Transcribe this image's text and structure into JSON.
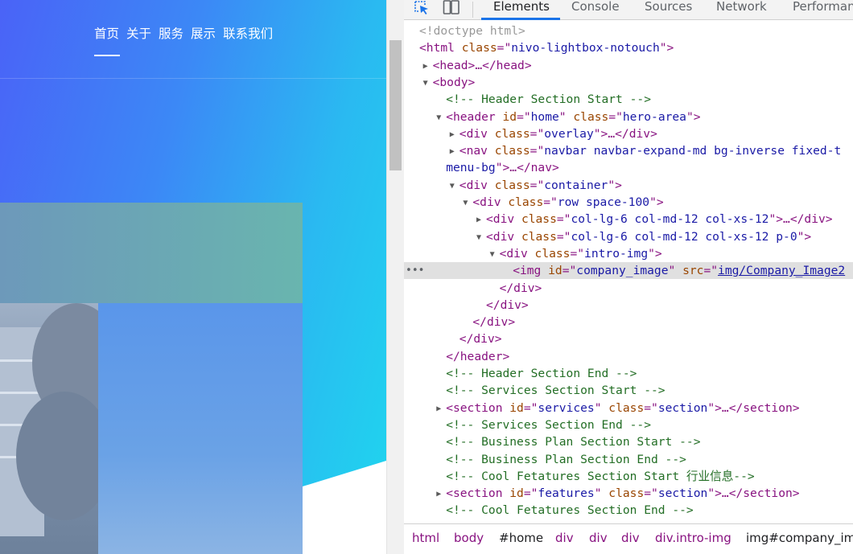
{
  "site": {
    "nav_links": [
      "首页",
      "关于",
      "服务",
      "展示",
      "联系我们"
    ],
    "active_link": "首页"
  },
  "devtools": {
    "tabs": [
      "Elements",
      "Console",
      "Sources",
      "Network",
      "Performan"
    ],
    "active_tab": "Elements",
    "selected_gutter": "•••",
    "tree": [
      {
        "indent": 0,
        "tri": "",
        "parts": [
          [
            "doctype",
            "<!doctype html>"
          ]
        ]
      },
      {
        "indent": 0,
        "tri": "",
        "parts": [
          [
            "tag",
            "<html "
          ],
          [
            "attr",
            "class"
          ],
          [
            "tag",
            "=\""
          ],
          [
            "val",
            "nivo-lightbox-notouch"
          ],
          [
            "tag",
            "\">"
          ]
        ]
      },
      {
        "indent": 1,
        "tri": "right",
        "parts": [
          [
            "tag",
            "<head>"
          ],
          [
            "ell",
            "…"
          ],
          [
            "tag",
            "</head>"
          ]
        ]
      },
      {
        "indent": 1,
        "tri": "down",
        "parts": [
          [
            "tag",
            "<body>"
          ]
        ]
      },
      {
        "indent": 2,
        "tri": "",
        "parts": [
          [
            "cmt",
            "<!-- Header Section Start -->"
          ]
        ]
      },
      {
        "indent": 2,
        "tri": "down",
        "parts": [
          [
            "tag",
            "<header "
          ],
          [
            "attr",
            "id"
          ],
          [
            "tag",
            "=\""
          ],
          [
            "val",
            "home"
          ],
          [
            "tag",
            "\" "
          ],
          [
            "attr",
            "class"
          ],
          [
            "tag",
            "=\""
          ],
          [
            "val",
            "hero-area"
          ],
          [
            "tag",
            "\">"
          ]
        ]
      },
      {
        "indent": 3,
        "tri": "right",
        "parts": [
          [
            "tag",
            "<div "
          ],
          [
            "attr",
            "class"
          ],
          [
            "tag",
            "=\""
          ],
          [
            "val",
            "overlay"
          ],
          [
            "tag",
            "\">"
          ],
          [
            "ell",
            "…"
          ],
          [
            "tag",
            "</div>"
          ]
        ]
      },
      {
        "indent": 3,
        "tri": "right",
        "parts": [
          [
            "tag",
            "<nav "
          ],
          [
            "attr",
            "class"
          ],
          [
            "tag",
            "=\""
          ],
          [
            "val",
            "navbar navbar-expand-md bg-inverse fixed-t"
          ]
        ]
      },
      {
        "indent": 2,
        "tri": "",
        "parts": [
          [
            "val",
            "menu-bg"
          ],
          [
            "tag",
            "\">"
          ],
          [
            "ell",
            "…"
          ],
          [
            "tag",
            "</nav>"
          ]
        ]
      },
      {
        "indent": 3,
        "tri": "down",
        "parts": [
          [
            "tag",
            "<div "
          ],
          [
            "attr",
            "class"
          ],
          [
            "tag",
            "=\""
          ],
          [
            "val",
            "container"
          ],
          [
            "tag",
            "\">"
          ]
        ]
      },
      {
        "indent": 4,
        "tri": "down",
        "parts": [
          [
            "tag",
            "<div "
          ],
          [
            "attr",
            "class"
          ],
          [
            "tag",
            "=\""
          ],
          [
            "val",
            "row space-100"
          ],
          [
            "tag",
            "\">"
          ]
        ]
      },
      {
        "indent": 5,
        "tri": "right",
        "parts": [
          [
            "tag",
            "<div "
          ],
          [
            "attr",
            "class"
          ],
          [
            "tag",
            "=\""
          ],
          [
            "val",
            "col-lg-6 col-md-12 col-xs-12"
          ],
          [
            "tag",
            "\">"
          ],
          [
            "ell",
            "…"
          ],
          [
            "tag",
            "</div>"
          ]
        ]
      },
      {
        "indent": 5,
        "tri": "down",
        "parts": [
          [
            "tag",
            "<div "
          ],
          [
            "attr",
            "class"
          ],
          [
            "tag",
            "=\""
          ],
          [
            "val",
            "col-lg-6 col-md-12 col-xs-12 p-0"
          ],
          [
            "tag",
            "\">"
          ]
        ]
      },
      {
        "indent": 6,
        "tri": "down",
        "parts": [
          [
            "tag",
            "<div "
          ],
          [
            "attr",
            "class"
          ],
          [
            "tag",
            "=\""
          ],
          [
            "val",
            "intro-img"
          ],
          [
            "tag",
            "\">"
          ]
        ]
      },
      {
        "indent": 7,
        "tri": "",
        "selected": true,
        "parts": [
          [
            "tag",
            "<img "
          ],
          [
            "attr",
            "id"
          ],
          [
            "tag",
            "=\""
          ],
          [
            "val",
            "company_image"
          ],
          [
            "tag",
            "\" "
          ],
          [
            "attr",
            "src"
          ],
          [
            "tag",
            "=\""
          ],
          [
            "link",
            "img/Company_Image2"
          ]
        ]
      },
      {
        "indent": 6,
        "tri": "",
        "parts": [
          [
            "tag",
            "</div>"
          ]
        ]
      },
      {
        "indent": 5,
        "tri": "",
        "parts": [
          [
            "tag",
            "</div>"
          ]
        ]
      },
      {
        "indent": 4,
        "tri": "",
        "parts": [
          [
            "tag",
            "</div>"
          ]
        ]
      },
      {
        "indent": 3,
        "tri": "",
        "parts": [
          [
            "tag",
            "</div>"
          ]
        ]
      },
      {
        "indent": 2,
        "tri": "",
        "parts": [
          [
            "tag",
            "</header>"
          ]
        ]
      },
      {
        "indent": 2,
        "tri": "",
        "parts": [
          [
            "cmt",
            "<!-- Header Section End -->"
          ]
        ]
      },
      {
        "indent": 2,
        "tri": "",
        "parts": [
          [
            "cmt",
            "<!-- Services Section Start -->"
          ]
        ]
      },
      {
        "indent": 2,
        "tri": "right",
        "parts": [
          [
            "tag",
            "<section "
          ],
          [
            "attr",
            "id"
          ],
          [
            "tag",
            "=\""
          ],
          [
            "val",
            "services"
          ],
          [
            "tag",
            "\" "
          ],
          [
            "attr",
            "class"
          ],
          [
            "tag",
            "=\""
          ],
          [
            "val",
            "section"
          ],
          [
            "tag",
            "\">"
          ],
          [
            "ell",
            "…"
          ],
          [
            "tag",
            "</section>"
          ]
        ]
      },
      {
        "indent": 2,
        "tri": "",
        "parts": [
          [
            "cmt",
            "<!-- Services Section End -->"
          ]
        ]
      },
      {
        "indent": 2,
        "tri": "",
        "parts": [
          [
            "cmt",
            "<!-- Business Plan Section Start -->"
          ]
        ]
      },
      {
        "indent": 2,
        "tri": "",
        "parts": [
          [
            "cmt",
            "<!-- Business Plan Section End -->"
          ]
        ]
      },
      {
        "indent": 2,
        "tri": "",
        "parts": [
          [
            "cmt",
            "<!-- Cool Fetatures Section Start  行业信息-->"
          ]
        ]
      },
      {
        "indent": 2,
        "tri": "right",
        "parts": [
          [
            "tag",
            "<section "
          ],
          [
            "attr",
            "id"
          ],
          [
            "tag",
            "=\""
          ],
          [
            "val",
            "features"
          ],
          [
            "tag",
            "\" "
          ],
          [
            "attr",
            "class"
          ],
          [
            "tag",
            "=\""
          ],
          [
            "val",
            "section"
          ],
          [
            "tag",
            "\">"
          ],
          [
            "ell",
            "…"
          ],
          [
            "tag",
            "</section>"
          ]
        ]
      },
      {
        "indent": 2,
        "tri": "",
        "parts": [
          [
            "cmt",
            "<!-- Cool Fetatures Section End -->"
          ]
        ]
      }
    ],
    "breadcrumbs": [
      "html",
      "body",
      "#home",
      "div",
      "div",
      "div",
      "div.intro-img",
      "img#company_ima"
    ]
  },
  "colors": {
    "tab_indicator": "#1a73e8",
    "tag": "#881280",
    "attr": "#994500",
    "value": "#1a1aa6",
    "comment": "#236e25"
  }
}
